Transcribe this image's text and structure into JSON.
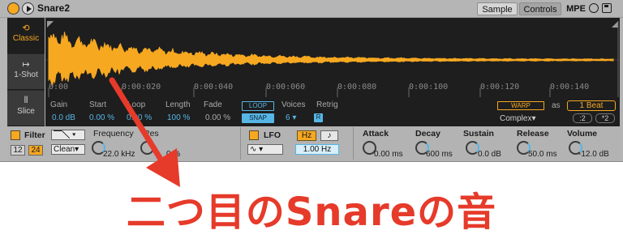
{
  "titlebar": {
    "device_name": "Snare2",
    "tabs": [
      "Sample",
      "Controls"
    ],
    "mpe_label": "MPE"
  },
  "modes": [
    {
      "label": "Classic",
      "icon": "classic-icon"
    },
    {
      "label": "1-Shot",
      "icon": "one-shot-icon"
    },
    {
      "label": "Slice",
      "icon": "slice-icon"
    }
  ],
  "timeline": [
    "0:00",
    "0:00:020",
    "0:00:040",
    "0:00:060",
    "0:00:080",
    "0:00:100",
    "0:00:120",
    "0:00:140"
  ],
  "sample": {
    "gain_label": "Gain",
    "gain_value": "0.0 dB",
    "start_label": "Start",
    "start_value": "0.00 %",
    "loop_label": "Loop",
    "loop_value": "0.00 %",
    "length_label": "Length",
    "length_value": "100 %",
    "fade_label": "Fade",
    "fade_value": "0.00 %",
    "loop_button": "LOOP",
    "snap_button": "SNAP",
    "voices_label": "Voices",
    "voices_value": "6",
    "retrig_label": "Retrig",
    "retrig_button": "R",
    "warp_button": "WARP",
    "as_label": "as",
    "beat_value": "1 Beat",
    "warp_mode": "Complex",
    "div_button": ":2",
    "mul_button": "*2"
  },
  "filter": {
    "label": "Filter",
    "poles": [
      "12",
      "24"
    ],
    "circuit": "Clean",
    "frequency_label": "Frequency",
    "res_label": "Res",
    "frequency_value": "22.0 kHz",
    "res_value": "0 %"
  },
  "lfo": {
    "label": "LFO",
    "hz_button": "Hz",
    "note_button": "♪",
    "rate_value": "1.00 Hz"
  },
  "envelope": {
    "attack_label": "Attack",
    "attack_value": "0.00 ms",
    "decay_label": "Decay",
    "decay_value": "600 ms",
    "sustain_label": "Sustain",
    "sustain_value": "0.0 dB",
    "release_label": "Release",
    "release_value": "50.0 ms",
    "volume_label": "Volume",
    "volume_value": "-12.0 dB"
  },
  "caption": "二つ目のSnareの音",
  "colors": {
    "accent_orange": "#f6a821",
    "accent_blue": "#56b6e6",
    "caption_red": "#e63a2a",
    "waveform": "#f6a821"
  }
}
